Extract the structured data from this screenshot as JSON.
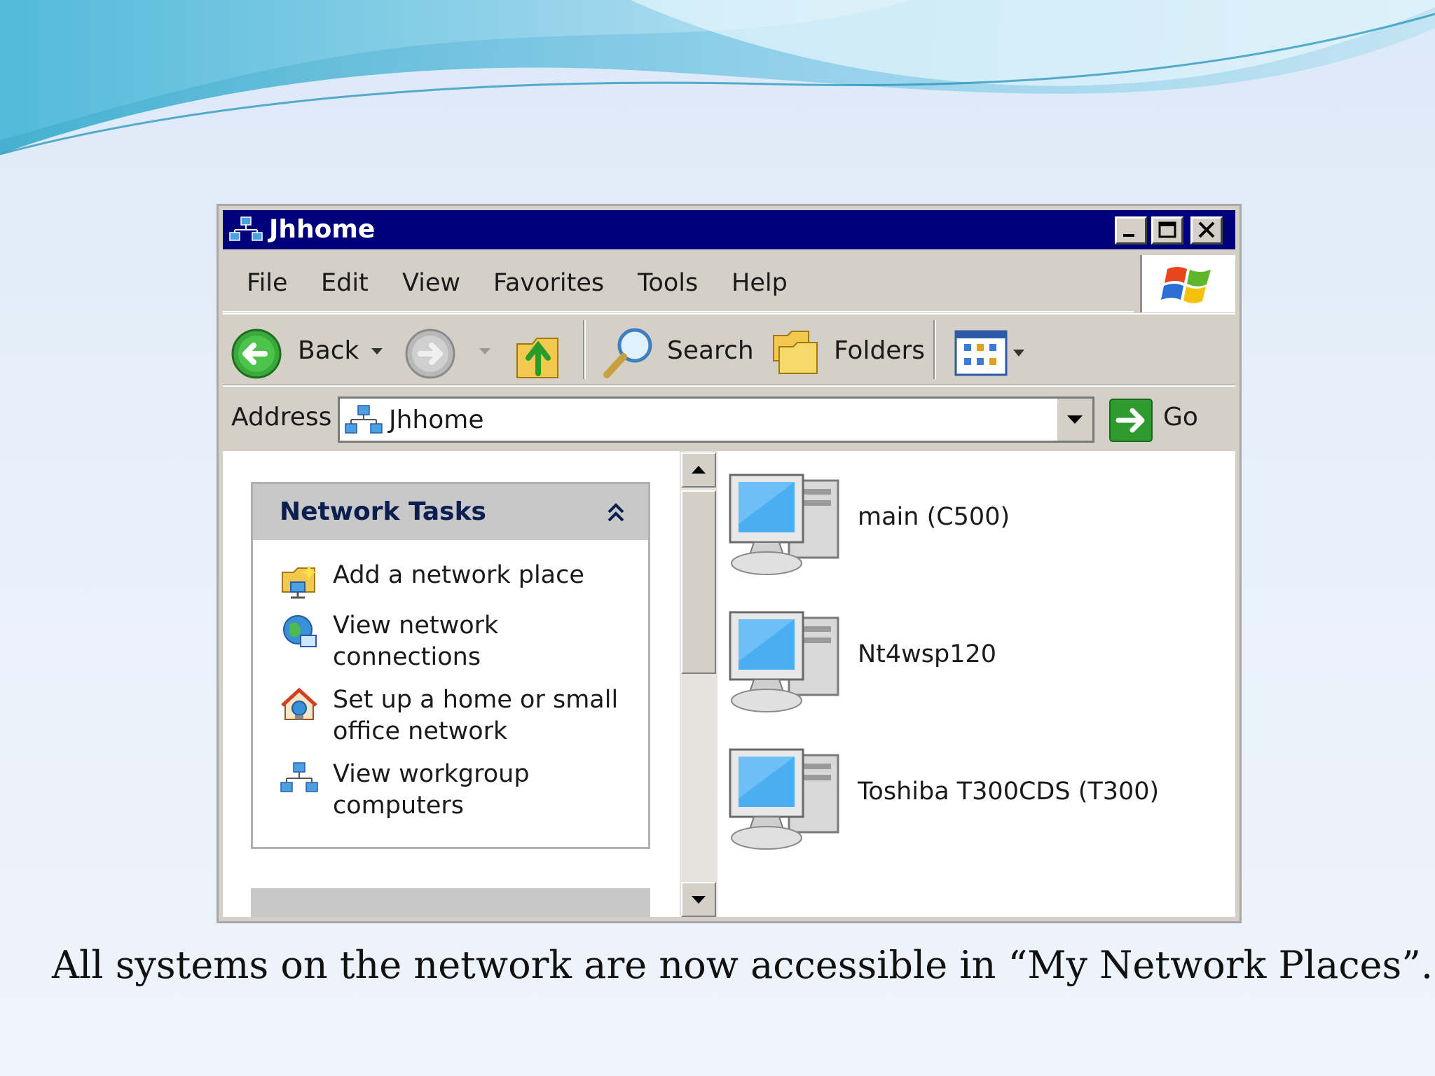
{
  "window": {
    "title": "Jhhome",
    "controls": {
      "minimize": "minimize",
      "maximize": "maximize",
      "close": "close"
    }
  },
  "menubar": {
    "items": [
      "File",
      "Edit",
      "View",
      "Favorites",
      "Tools",
      "Help"
    ]
  },
  "toolbar": {
    "back_label": "Back",
    "search_label": "Search",
    "folders_label": "Folders"
  },
  "addressbar": {
    "label": "Address",
    "value": "Jhhome",
    "go_label": "Go"
  },
  "tasks": {
    "title": "Network Tasks",
    "items": [
      {
        "label": "Add a network place",
        "icon": "add-network-place-icon"
      },
      {
        "label": "View network connections",
        "icon": "network-connections-icon"
      },
      {
        "label": "Set up a home or small office network",
        "icon": "home-network-icon"
      },
      {
        "label": "View workgroup computers",
        "icon": "workgroup-icon"
      }
    ]
  },
  "computers": [
    {
      "label": "main (C500)"
    },
    {
      "label": "Nt4wsp120"
    },
    {
      "label": "Toshiba T300CDS (T300)"
    }
  ],
  "caption": "All systems on the network are now accessible in “My Network Places”.",
  "colors": {
    "titlebar": "#00007b",
    "chrome": "#d4d0c8",
    "tasks_header": "#c8c8c8",
    "tasks_title": "#0a1e50"
  }
}
